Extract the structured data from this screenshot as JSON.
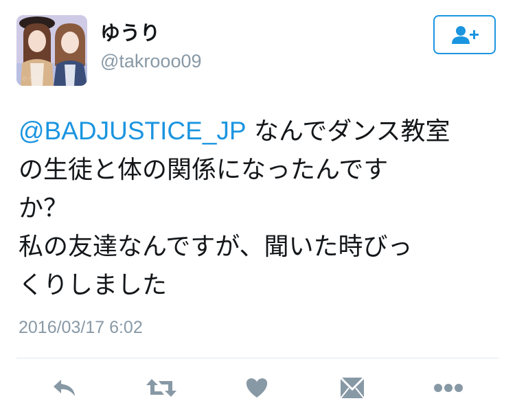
{
  "user": {
    "display_name": "ゆうり",
    "handle": "@takrooo09"
  },
  "tweet": {
    "mention": "@BADJUSTICE_JP",
    "line1_rest": " なんでダンス教室",
    "line2": "の生徒と体の関係になったんです",
    "line3": "か？",
    "line4": "私の友達なんですが、聞いた時びっ",
    "line5": "くりしました",
    "timestamp": "2016/03/17 6:02"
  },
  "actions": [
    {
      "icon": "reply-icon"
    },
    {
      "icon": "retweet-icon"
    },
    {
      "icon": "like-heart-icon"
    },
    {
      "icon": "direct-message-icon"
    },
    {
      "icon": "more-options-icon"
    }
  ],
  "colors": {
    "accent": "#1b95e0",
    "text": "#14171a",
    "muted": "#8899a6",
    "action_icon": "#8899a6",
    "divider": "#e1e8ed"
  }
}
